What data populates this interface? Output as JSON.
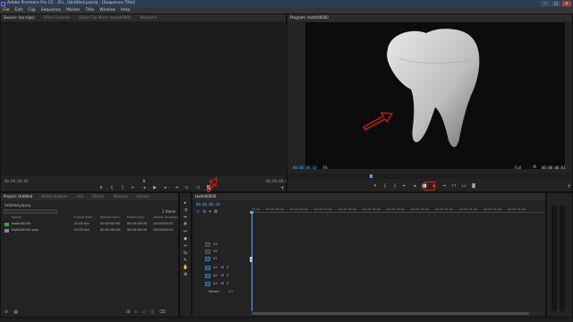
{
  "window": {
    "title": "Adobe Premiere Pro CC - D:\\...\\Untitled.prproj - [Sequence Title]",
    "buttons": [
      "–",
      "□",
      "✕"
    ]
  },
  "menu": [
    "File",
    "Edit",
    "Clip",
    "Sequence",
    "Marker",
    "Title",
    "Window",
    "Help"
  ],
  "source_panel": {
    "tabs": [
      "Source: (no clips)",
      "Effect Controls",
      "Audio Clip Mixer: tooth00000",
      "Metadata"
    ],
    "timecode_left": "00;00;00;00",
    "timecode_right": "00;00;00;00",
    "buttons": [
      "marker-icon",
      "in-icon",
      "out-icon",
      "goto-in-icon",
      "step-back-icon",
      "play-icon",
      "step-fwd-icon",
      "goto-out-icon",
      "insert-icon",
      "overwrite-icon",
      "export-frame-icon"
    ]
  },
  "program_panel": {
    "tab": "Program: tooth00000",
    "timecode": "00:00:00:10",
    "fit": "Fit",
    "quality": "Full",
    "duration": "00:00:00:01",
    "buttons": [
      "marker-icon",
      "in-icon",
      "out-icon",
      "goto-in-icon",
      "step-back-icon",
      "stop-icon",
      "step-fwd-icon",
      "goto-out-icon",
      "lift-icon",
      "extract-icon",
      "export-frame-icon"
    ]
  },
  "project_panel": {
    "tabs": [
      "Project: Untitled",
      "Media Browser",
      "Info",
      "Effects",
      "Markers",
      "History"
    ],
    "project_file": "Untitled.prproj",
    "item_count": "2 Items",
    "columns": [
      "Name",
      "Frame Rate",
      "Media Start",
      "Media End",
      "Media Duration"
    ],
    "rows": [
      {
        "name": "tooth00000",
        "color": "#3ba53b",
        "frame_rate": "25.00 fps",
        "media_start": "00:00:00:00",
        "media_end": "00:00:00:00",
        "media_duration": "00:00:00:01"
      },
      {
        "name": "tooth00000.png",
        "color": "#8a7cd8",
        "frame_rate": "25.00 fps",
        "media_start": "00:00:00:00",
        "media_end": "00:00:00:00",
        "media_duration": "00:00:00:01"
      }
    ]
  },
  "timeline_panel": {
    "tab": "tooth00000",
    "timecode": "00:00:00:10",
    "ruler": [
      "00:00",
      "00:00:05:00",
      "00:00:10:00",
      "00:00:15:00",
      "00:00:20:00",
      "00:00:25:00",
      "00:00:30:00",
      "00:00:35:00",
      "00:00:40:00",
      "00:00:45:00",
      "00:00:50:00",
      "00:00:55:00"
    ],
    "video_tracks": [
      "V3",
      "V2",
      "V1"
    ],
    "audio_tracks": [
      "A1",
      "A2",
      "A3"
    ],
    "master": "Master",
    "master_level": "0.0"
  },
  "colors": {
    "accent": "#5da2ff",
    "annotation": "#d61c1c"
  }
}
